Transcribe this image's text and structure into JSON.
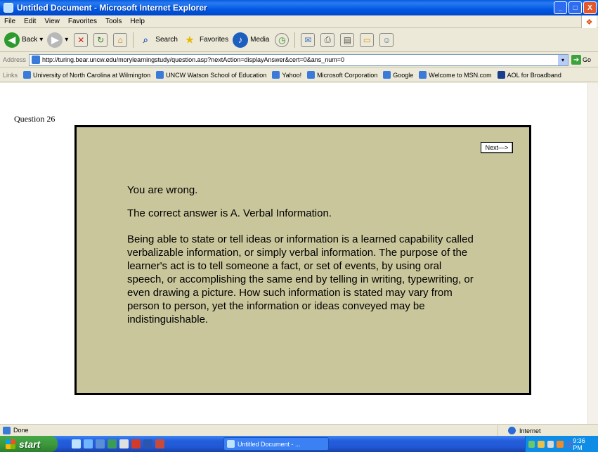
{
  "window": {
    "title": "Untitled Document - Microsoft Internet Explorer",
    "controls": [
      "_",
      "□",
      "X"
    ]
  },
  "menu": [
    "File",
    "Edit",
    "View",
    "Favorites",
    "Tools",
    "Help"
  ],
  "toolbar": {
    "back_label": "Back",
    "search_label": "Search",
    "favorites_label": "Favorites",
    "media_label": "Media"
  },
  "address": {
    "label": "Address",
    "url": "http://turing.bear.uncw.edu/morylearningstudy/question.asp?nextAction=displayAnswer&cert=0&ans_num=0",
    "go_label": "Go"
  },
  "links": {
    "label": "Links",
    "items": [
      "University of North Carolina at Wilmington",
      "UNCW Watson School of Education",
      "Yahoo!",
      "Microsoft Corporation",
      "Google",
      "Welcome to MSN.com",
      "AOL for Broadband"
    ]
  },
  "page": {
    "question_label": "Question 26",
    "next_button": "Next—>",
    "result": "You are wrong.",
    "correct_answer": "The correct answer is A. Verbal Information.",
    "explanation": "Being able to state or tell ideas or information is a learned capability called verbalizable information, or simply verbal information. The purpose of the learner's act is to tell someone a fact, or set of events, by using oral speech, or accomplishing the same end by telling in writing, typewriting, or even drawing a picture. How such information is stated may vary from person to person, yet the information or ideas conveyed may be indistinguishable."
  },
  "status": {
    "text": "Done",
    "zone": "Internet"
  },
  "taskbar": {
    "start_label": "start",
    "task_item": "Untitled Document - ...",
    "clock": "9:36 PM"
  },
  "colors": {
    "card_background": "#c9c69b",
    "titlebar_blue": "#0058e6",
    "taskbar_blue": "#245edb"
  }
}
